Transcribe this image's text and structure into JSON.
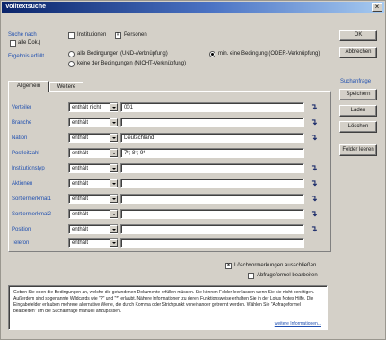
{
  "window": {
    "title": "Volltextsuche",
    "close_glyph": "×"
  },
  "search_in": {
    "label": "Suche nach",
    "all_docs_label": "alle Dok.)",
    "institutionen_label": "Institutionen",
    "personen_label": "Personen"
  },
  "result": {
    "label": "Ergebnis erfüllt",
    "opt_all": "alle Bedingungen (UND-Verknüpfung)",
    "opt_min": "min. eine Bedingung (ODER-Verknüpfung)",
    "opt_none": "keine der Bedingungen (NICHT-Verknüpfung)"
  },
  "buttons": {
    "ok": "OK",
    "cancel": "Abbrechen",
    "query_label": "Suchanfrage",
    "save": "Speichern",
    "load": "Laden",
    "delete": "Löschen",
    "clear_fields": "Felder leeren"
  },
  "tabs": {
    "general": "Allgemein",
    "more": "Weitere"
  },
  "rows": [
    {
      "label": "Verteiler",
      "op": "enthält nicht",
      "value": "001"
    },
    {
      "label": "Branche",
      "op": "enthält",
      "value": ""
    },
    {
      "label": "Nation",
      "op": "enthält",
      "value": "Deutschland"
    },
    {
      "label": "Postleitzahl",
      "op": "enthält",
      "value": "7*; 8*; 9*"
    },
    {
      "label": "Institutionstyp",
      "op": "enthält",
      "value": ""
    },
    {
      "label": "Aktionen",
      "op": "enthält",
      "value": ""
    },
    {
      "label": "Sortiermerkmal1",
      "op": "enthält",
      "value": ""
    },
    {
      "label": "Sortiermerkmal2",
      "op": "enthält",
      "value": ""
    },
    {
      "label": "Position",
      "op": "enthält",
      "value": ""
    },
    {
      "label": "Telefon",
      "op": "enthält",
      "value": ""
    }
  ],
  "options": {
    "exclude_deleted": "Löschvormerkungen ausschließen",
    "edit_formula": "Abfrageformel bearbeiten"
  },
  "info": {
    "text": "Geben Sie oben die Bedingungen an, welche die gefundenen Dokumente erfüllen müssen. Sie können Felder leer lassen wenn Sie sie nicht benötigen. Außerdem sind sogenannte Wildcards wie \"?\" und \"*\" erlaubt. Nähere Informationen zu deren Funktionsweise erhalten Sie in der Lotus Notes Hilfe. Die Eingabefelder erlauben mehrere alternative Werte, die durch Komma oder Strichpunkt voneinander getrennt werden. Wählen Sie \"Abfrageformel bearbeiten\" um die Suchanfrage manuell anzupassen.",
    "more_link": "weitere Informationen..."
  }
}
